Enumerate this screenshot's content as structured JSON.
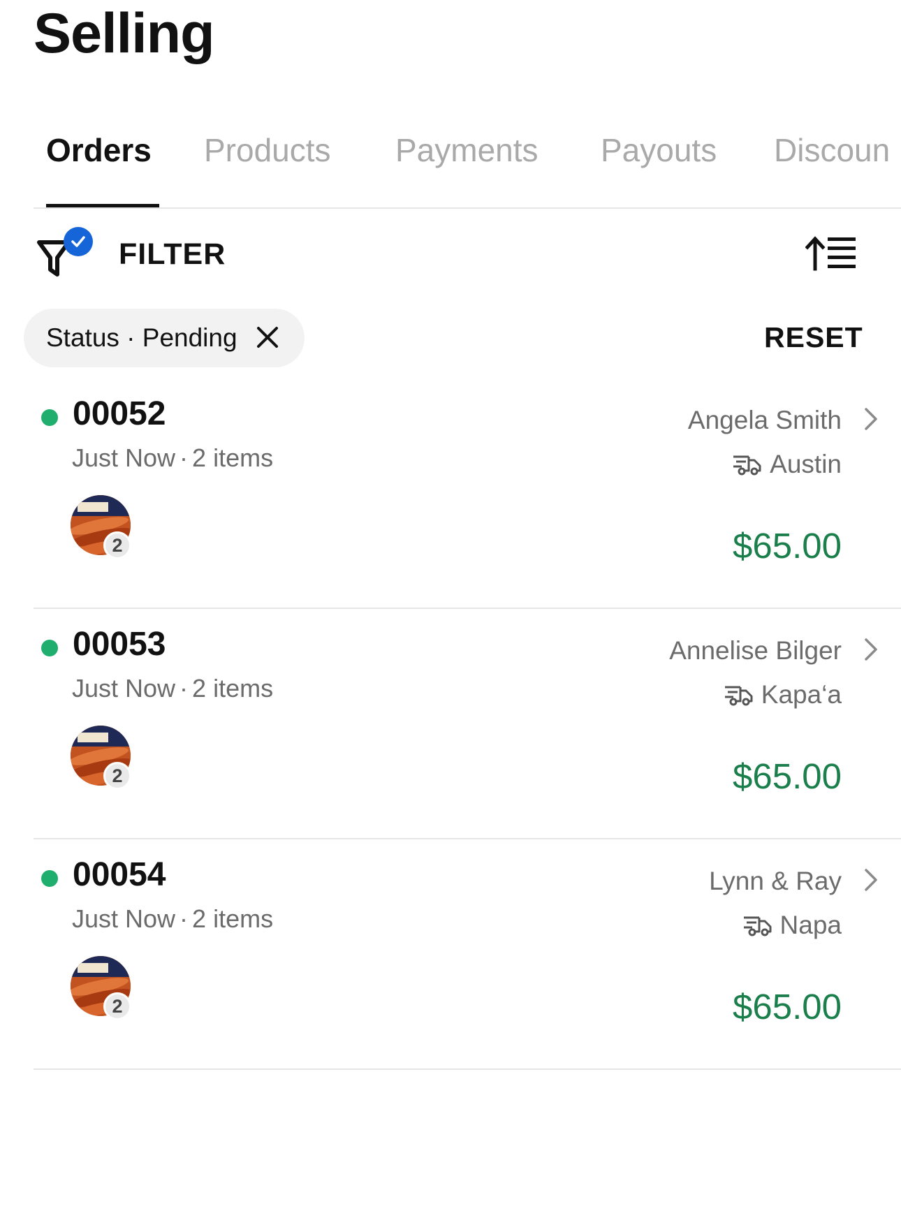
{
  "page": {
    "title": "Selling"
  },
  "tabs": [
    {
      "label": "Orders",
      "active": true
    },
    {
      "label": "Products",
      "active": false
    },
    {
      "label": "Payments",
      "active": false
    },
    {
      "label": "Payouts",
      "active": false
    },
    {
      "label": "Discoun",
      "active": false
    }
  ],
  "filter": {
    "label": "FILTER",
    "active": true
  },
  "active_filter_chip": {
    "label": "Status · Pending"
  },
  "reset": {
    "label": "RESET"
  },
  "orders": [
    {
      "number": "00052",
      "time": "Just Now",
      "separator": "·",
      "items": "2 items",
      "customer": "Angela Smith",
      "location": "Austin",
      "price": "$65.00",
      "qty": "2"
    },
    {
      "number": "00053",
      "time": "Just Now",
      "separator": "·",
      "items": "2 items",
      "customer": "Annelise Bilger",
      "location": "Kapa‘a",
      "price": "$65.00",
      "qty": "2"
    },
    {
      "number": "00054",
      "time": "Just Now",
      "separator": "·",
      "items": "2 items",
      "customer": "Lynn & Ray",
      "location": "Napa",
      "price": "$65.00",
      "qty": "2"
    }
  ],
  "colors": {
    "status_dot": "#1fae6d",
    "price": "#1b7f4c",
    "filter_check": "#1565d8",
    "inactive_tab": "#a9a9a9",
    "muted_text": "#6b6b6b"
  },
  "icons": {
    "filter": "filter-funnel-icon",
    "filter_active": "checkmark-badge-icon",
    "sort": "sort-ascending-icon",
    "chip_close": "close-icon",
    "row": "chevron-right-icon",
    "shipping": "delivery-truck-icon"
  }
}
